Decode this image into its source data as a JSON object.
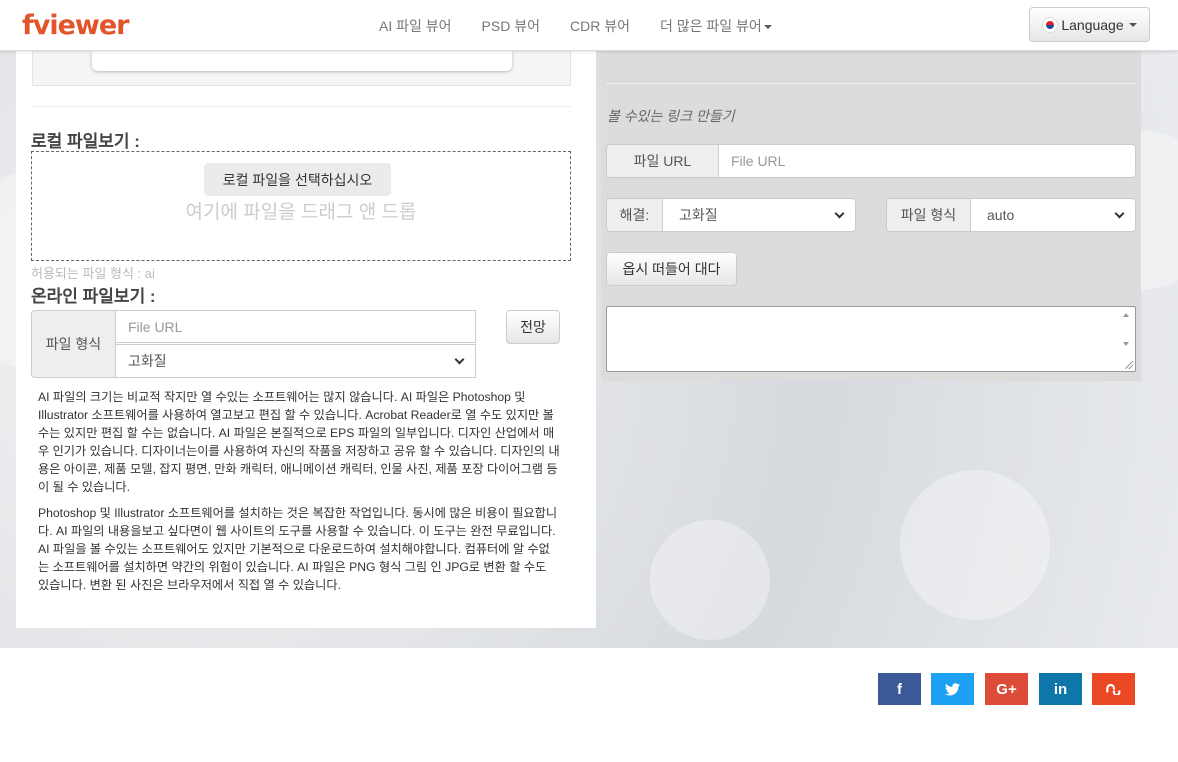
{
  "brand": {
    "logo": "fviewer"
  },
  "nav": {
    "links": [
      "AI 파일 뷰어",
      "PSD 뷰어",
      "CDR 뷰어",
      "더 많은 파일 뷰어"
    ],
    "language_label": "Language"
  },
  "local": {
    "title": "로컬 파일보기 :",
    "select_button": "로컬 파일을 선택하십시오",
    "drop_text": "여기에 파일을 드래그 앤 드롭",
    "allowed": "허용되는 파일 형식 : ai"
  },
  "online": {
    "title": "온라인 파일보기 :",
    "format_label": "파일 형식",
    "url_placeholder": "File URL",
    "quality_value": "고화질",
    "view_button": "전망"
  },
  "description": {
    "p1": "AI 파일의 크기는 비교적 작지만 열 수있는 소프트웨어는 많지 않습니다. AI 파일은 Photoshop 및 Illustrator 소프트웨어를 사용하여 열고보고 편집 할 수 있습니다. Acrobat Reader로 열 수도 있지만 볼 수는 있지만 편집 할 수는 없습니다. AI 파일은 본질적으로 EPS 파일의 일부입니다. 디자인 산업에서 매우 인기가 있습니다. 디자이너는이를 사용하여 자신의 작품을 저장하고 공유 할 수 있습니다. 디자인의 내용은 아이콘, 제품 모델, 잡지 평면, 만화 캐릭터, 애니메이션 캐릭터, 인물 사진, 제품 포장 다이어그램 등이 될 수 있습니다.",
    "p2": "Photoshop 및 Illustrator 소프트웨어를 설치하는 것은 복잡한 작업입니다. 동시에 많은 비용이 필요합니다. AI 파일의 내용을보고 싶다면이 웹 사이트의 도구를 사용할 수 있습니다. 이 도구는 완전 무료입니다. AI 파일을 볼 수있는 소프트웨어도 있지만 기본적으로 다운로드하여 설치해야합니다. 컴퓨터에 알 수없는 소프트웨어를 설치하면 약간의 위험이 있습니다. AI 파일은 PNG 형식 그림 인 JPG로 변환 할 수도 있습니다. 변환 된 사진은 브라우저에서 직접 열 수 있습니다."
  },
  "embed": {
    "caption": "볼 수있는 링크 만들기",
    "url_label": "파일 URL",
    "url_placeholder": "File URL",
    "resolution_label": "해결:",
    "resolution_value": "고화질",
    "format_label": "파일 형식",
    "format_value": "auto",
    "button": "옵시 떠들어 대다"
  },
  "social": [
    {
      "name": "facebook",
      "glyph": "f",
      "color": "#3b5998"
    },
    {
      "name": "twitter",
      "glyph": "t",
      "color": "#1da1f2"
    },
    {
      "name": "google-plus",
      "glyph": "G+",
      "color": "#dd4b39"
    },
    {
      "name": "linkedin",
      "glyph": "in",
      "color": "#0e76a8"
    },
    {
      "name": "stumbleupon",
      "glyph": "su",
      "color": "#eb4924"
    }
  ]
}
